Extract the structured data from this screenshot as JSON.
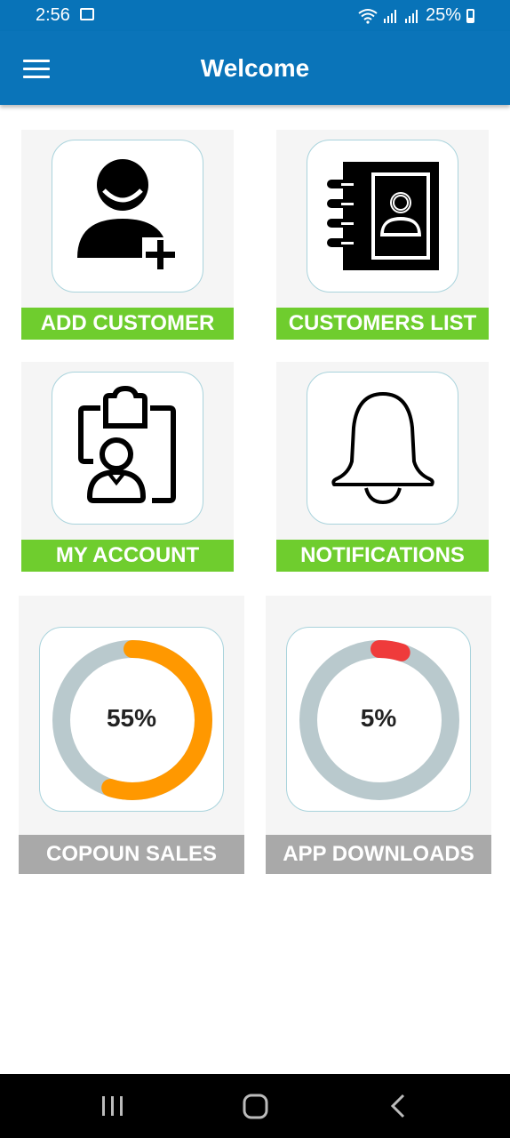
{
  "status_bar": {
    "time": "2:56",
    "battery": "25%"
  },
  "app_bar": {
    "title": "Welcome"
  },
  "tiles": [
    {
      "label": "ADD CUSTOMER",
      "icon": "add-user-icon"
    },
    {
      "label": "CUSTOMERS LIST",
      "icon": "contact-book-icon"
    },
    {
      "label": "MY ACCOUNT",
      "icon": "account-clipboard-icon"
    },
    {
      "label": "NOTIFICATIONS",
      "icon": "bell-icon"
    }
  ],
  "stats": [
    {
      "label": "COPOUN SALES",
      "value_text": "55%",
      "value": 55,
      "color": "#ff9800",
      "track_color": "#b9c9cd"
    },
    {
      "label": "APP DOWNLOADS",
      "value_text": "5%",
      "value": 5,
      "color": "#ef3b3b",
      "track_color": "#b9c9cd"
    }
  ],
  "colors": {
    "primary": "#0a74b9",
    "tile_label": "#6fcd2e",
    "stat_label": "#a9a9a9"
  },
  "nav_bar": {
    "buttons": [
      "recent-apps-icon",
      "home-icon",
      "back-icon"
    ]
  }
}
